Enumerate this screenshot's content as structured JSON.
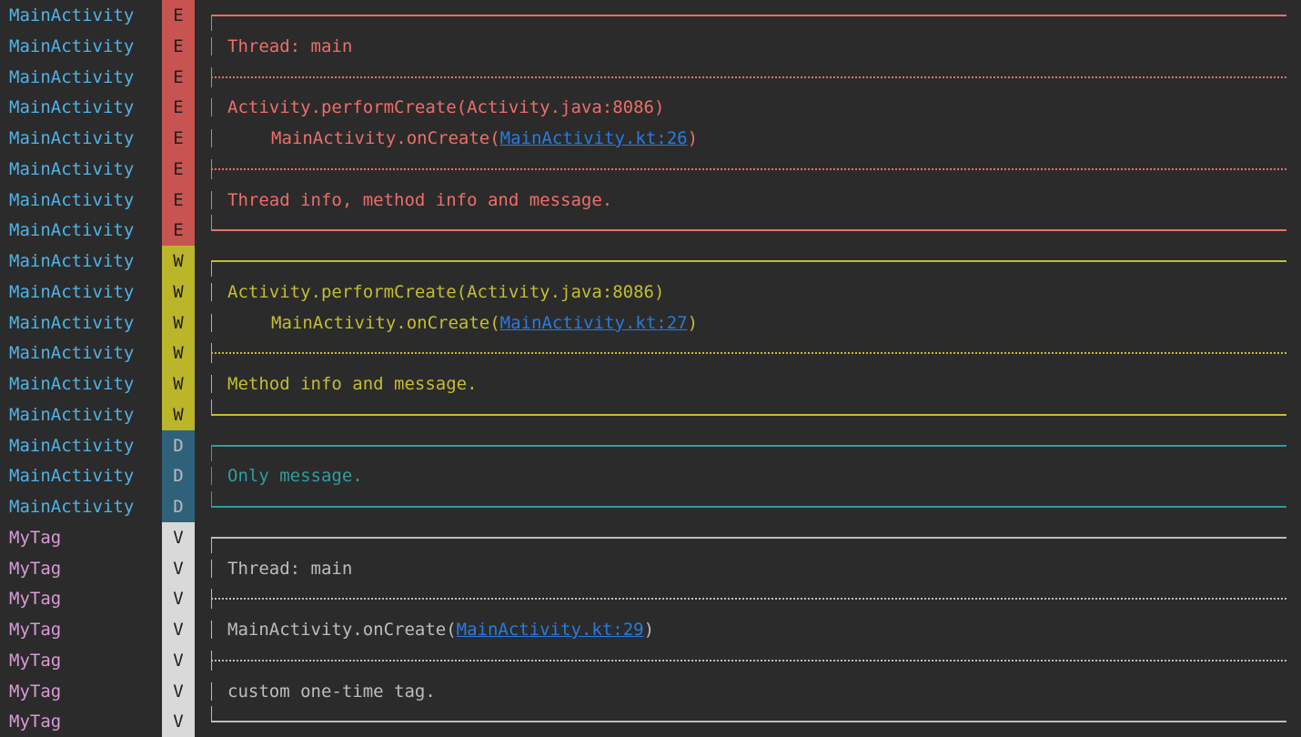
{
  "colors": {
    "tag_main": "#4fb3e8",
    "tag_mytag": "#d99bd6",
    "E": {
      "bg": "#c75450",
      "fg": "#1e1e1e",
      "text": "#ee6e6a"
    },
    "W": {
      "bg": "#bbb529",
      "fg": "#1e1e1e",
      "text": "#c4bd33"
    },
    "D": {
      "bg": "#30617a",
      "fg": "#bbbbbb",
      "text": "#2e9e9e"
    },
    "V": {
      "bg": "#d9d9d9",
      "fg": "#1e1e1e",
      "text": "#bdbdbd"
    },
    "link": "#287bde"
  },
  "rows": [
    {
      "tag": "MainActivity",
      "level": "E",
      "kind": "top"
    },
    {
      "tag": "MainActivity",
      "level": "E",
      "kind": "text",
      "text": "Thread: main"
    },
    {
      "tag": "MainActivity",
      "level": "E",
      "kind": "divider"
    },
    {
      "tag": "MainActivity",
      "level": "E",
      "kind": "text",
      "text": "Activity.performCreate(Activity.java:8086)"
    },
    {
      "tag": "MainActivity",
      "level": "E",
      "kind": "text",
      "indent": true,
      "text": "MainActivity.onCreate(",
      "link": "MainActivity.kt:26",
      "after": ")"
    },
    {
      "tag": "MainActivity",
      "level": "E",
      "kind": "divider"
    },
    {
      "tag": "MainActivity",
      "level": "E",
      "kind": "text",
      "text": "Thread info, method info and message."
    },
    {
      "tag": "MainActivity",
      "level": "E",
      "kind": "bottom"
    },
    {
      "tag": "MainActivity",
      "level": "W",
      "kind": "top"
    },
    {
      "tag": "MainActivity",
      "level": "W",
      "kind": "text",
      "text": "Activity.performCreate(Activity.java:8086)"
    },
    {
      "tag": "MainActivity",
      "level": "W",
      "kind": "text",
      "indent": true,
      "text": "MainActivity.onCreate(",
      "link": "MainActivity.kt:27",
      "after": ")"
    },
    {
      "tag": "MainActivity",
      "level": "W",
      "kind": "divider"
    },
    {
      "tag": "MainActivity",
      "level": "W",
      "kind": "text",
      "text": "Method info and message."
    },
    {
      "tag": "MainActivity",
      "level": "W",
      "kind": "bottom"
    },
    {
      "tag": "MainActivity",
      "level": "D",
      "kind": "top"
    },
    {
      "tag": "MainActivity",
      "level": "D",
      "kind": "text",
      "text": "Only message."
    },
    {
      "tag": "MainActivity",
      "level": "D",
      "kind": "bottom"
    },
    {
      "tag": "MyTag",
      "level": "V",
      "kind": "top"
    },
    {
      "tag": "MyTag",
      "level": "V",
      "kind": "text",
      "text": "Thread: main"
    },
    {
      "tag": "MyTag",
      "level": "V",
      "kind": "divider"
    },
    {
      "tag": "MyTag",
      "level": "V",
      "kind": "text",
      "text": "MainActivity.onCreate(",
      "link": "MainActivity.kt:29",
      "after": ")"
    },
    {
      "tag": "MyTag",
      "level": "V",
      "kind": "divider"
    },
    {
      "tag": "MyTag",
      "level": "V",
      "kind": "text",
      "text": "custom one-time tag."
    },
    {
      "tag": "MyTag",
      "level": "V",
      "kind": "bottom"
    }
  ]
}
